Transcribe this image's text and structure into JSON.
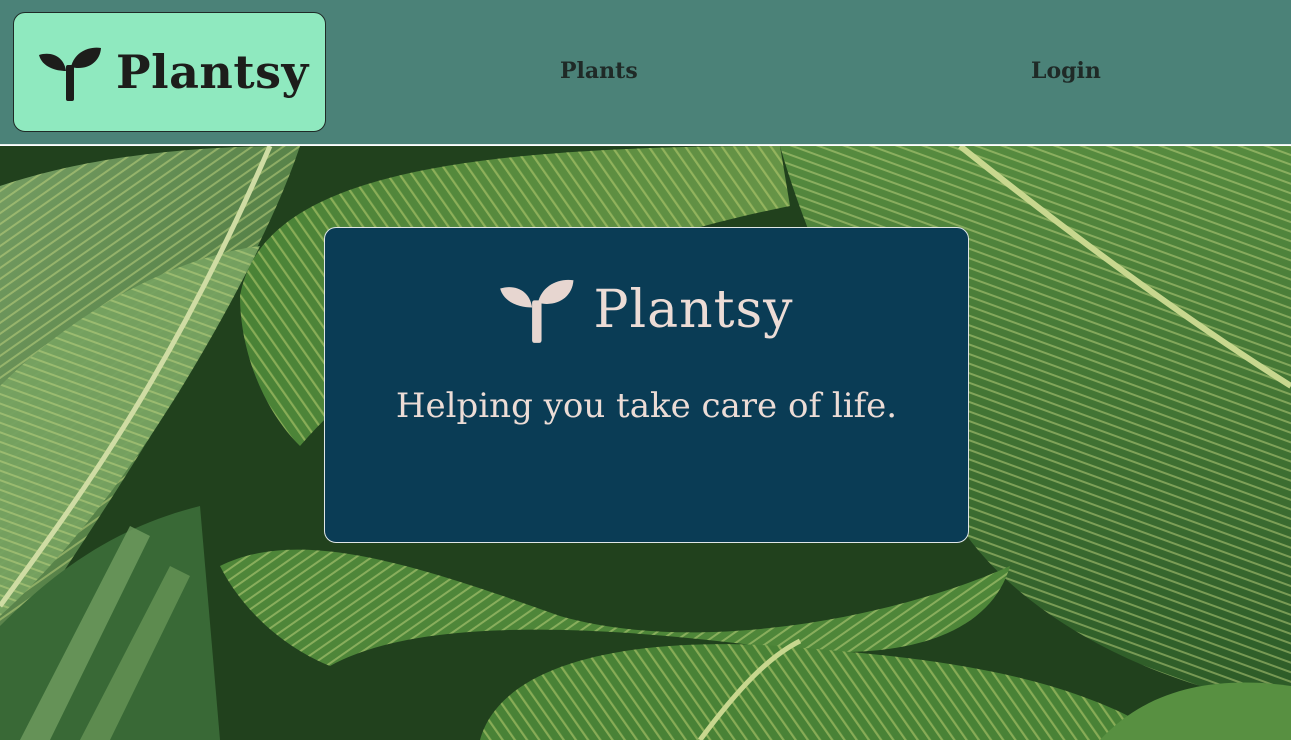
{
  "header": {
    "brand_name": "Plantsy",
    "brand_icon": "sprout-icon",
    "nav": {
      "plants_label": "Plants",
      "login_label": "Login"
    }
  },
  "hero": {
    "background": "tropical leaves photo",
    "card": {
      "brand_name": "Plantsy",
      "brand_icon": "sprout-icon",
      "tagline": "Helping you take care of life."
    }
  },
  "colors": {
    "nav_background": "#4b8278",
    "brand_badge": "#8fe9bf",
    "card_background": "#0a3c55",
    "card_text": "#ecdcd6",
    "nav_text": "#1f2a27"
  }
}
